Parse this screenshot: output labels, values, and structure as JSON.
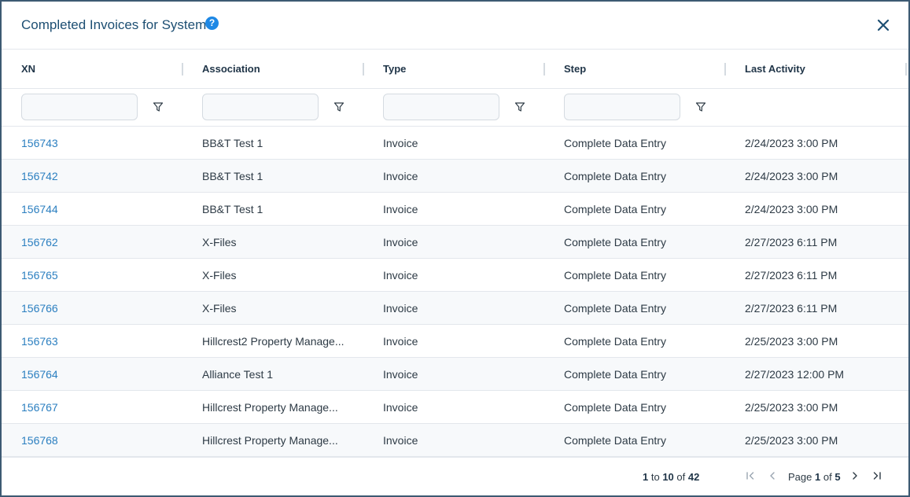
{
  "dialog": {
    "title": "Completed Invoices for System",
    "help_icon": "?"
  },
  "columns": [
    {
      "label": "XN"
    },
    {
      "label": "Association"
    },
    {
      "label": "Type"
    },
    {
      "label": "Step"
    },
    {
      "label": "Last Activity"
    }
  ],
  "rows": [
    {
      "xn": "156743",
      "association": "BB&T Test 1",
      "type": "Invoice",
      "step": "Complete Data Entry",
      "last_activity": "2/24/2023 3:00 PM"
    },
    {
      "xn": "156742",
      "association": "BB&T Test 1",
      "type": "Invoice",
      "step": "Complete Data Entry",
      "last_activity": "2/24/2023 3:00 PM"
    },
    {
      "xn": "156744",
      "association": "BB&T Test 1",
      "type": "Invoice",
      "step": "Complete Data Entry",
      "last_activity": "2/24/2023 3:00 PM"
    },
    {
      "xn": "156762",
      "association": "X-Files",
      "type": "Invoice",
      "step": "Complete Data Entry",
      "last_activity": "2/27/2023 6:11 PM"
    },
    {
      "xn": "156765",
      "association": "X-Files",
      "type": "Invoice",
      "step": "Complete Data Entry",
      "last_activity": "2/27/2023 6:11 PM"
    },
    {
      "xn": "156766",
      "association": "X-Files",
      "type": "Invoice",
      "step": "Complete Data Entry",
      "last_activity": "2/27/2023 6:11 PM"
    },
    {
      "xn": "156763",
      "association": "Hillcrest2 Property Manage...",
      "type": "Invoice",
      "step": "Complete Data Entry",
      "last_activity": "2/25/2023 3:00 PM"
    },
    {
      "xn": "156764",
      "association": "Alliance Test 1",
      "type": "Invoice",
      "step": "Complete Data Entry",
      "last_activity": "2/27/2023 12:00 PM"
    },
    {
      "xn": "156767",
      "association": "Hillcrest Property Manage...",
      "type": "Invoice",
      "step": "Complete Data Entry",
      "last_activity": "2/25/2023 3:00 PM"
    },
    {
      "xn": "156768",
      "association": "Hillcrest Property Manage...",
      "type": "Invoice",
      "step": "Complete Data Entry",
      "last_activity": "2/25/2023 3:00 PM"
    }
  ],
  "footer": {
    "range_start": "1",
    "range_to": "to",
    "range_end": "10",
    "range_of": "of",
    "total": "42",
    "page_label": "Page",
    "page_current": "1",
    "page_of": "of",
    "page_total": "5"
  },
  "colors": {
    "link": "#2b7fc0",
    "title": "#1d4f73",
    "help": "#1e88e5",
    "alt_row": "#f7f9fb"
  },
  "icons": [
    "help-icon",
    "close-icon",
    "filter-icon",
    "first-page-icon",
    "previous-page-icon",
    "next-page-icon",
    "last-page-icon"
  ]
}
